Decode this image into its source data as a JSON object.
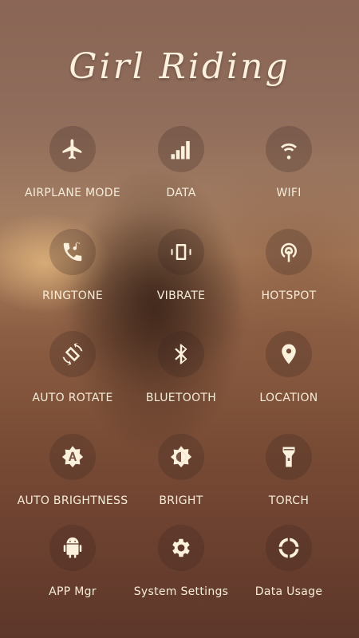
{
  "title": "Girl Riding",
  "tiles": [
    {
      "label": "AIRPLANE MODE",
      "icon": "airplane-icon"
    },
    {
      "label": "DATA",
      "icon": "signal-bars-icon"
    },
    {
      "label": "WIFI",
      "icon": "wifi-icon"
    },
    {
      "label": "RINGTONE",
      "icon": "ringtone-icon"
    },
    {
      "label": "VIBRATE",
      "icon": "vibrate-icon"
    },
    {
      "label": "HOTSPOT",
      "icon": "hotspot-icon"
    },
    {
      "label": "AUTO ROTATE",
      "icon": "auto-rotate-icon"
    },
    {
      "label": "BLUETOOTH",
      "icon": "bluetooth-icon"
    },
    {
      "label": "LOCATION",
      "icon": "location-pin-icon"
    },
    {
      "label": "AUTO BRIGHTNESS",
      "icon": "auto-brightness-icon"
    },
    {
      "label": "BRIGHT",
      "icon": "brightness-icon"
    },
    {
      "label": "TORCH",
      "icon": "torch-icon"
    },
    {
      "label": "APP Mgr",
      "icon": "android-icon"
    },
    {
      "label": "System Settings",
      "icon": "gear-icon"
    },
    {
      "label": "Data Usage",
      "icon": "data-usage-ring-icon"
    }
  ]
}
